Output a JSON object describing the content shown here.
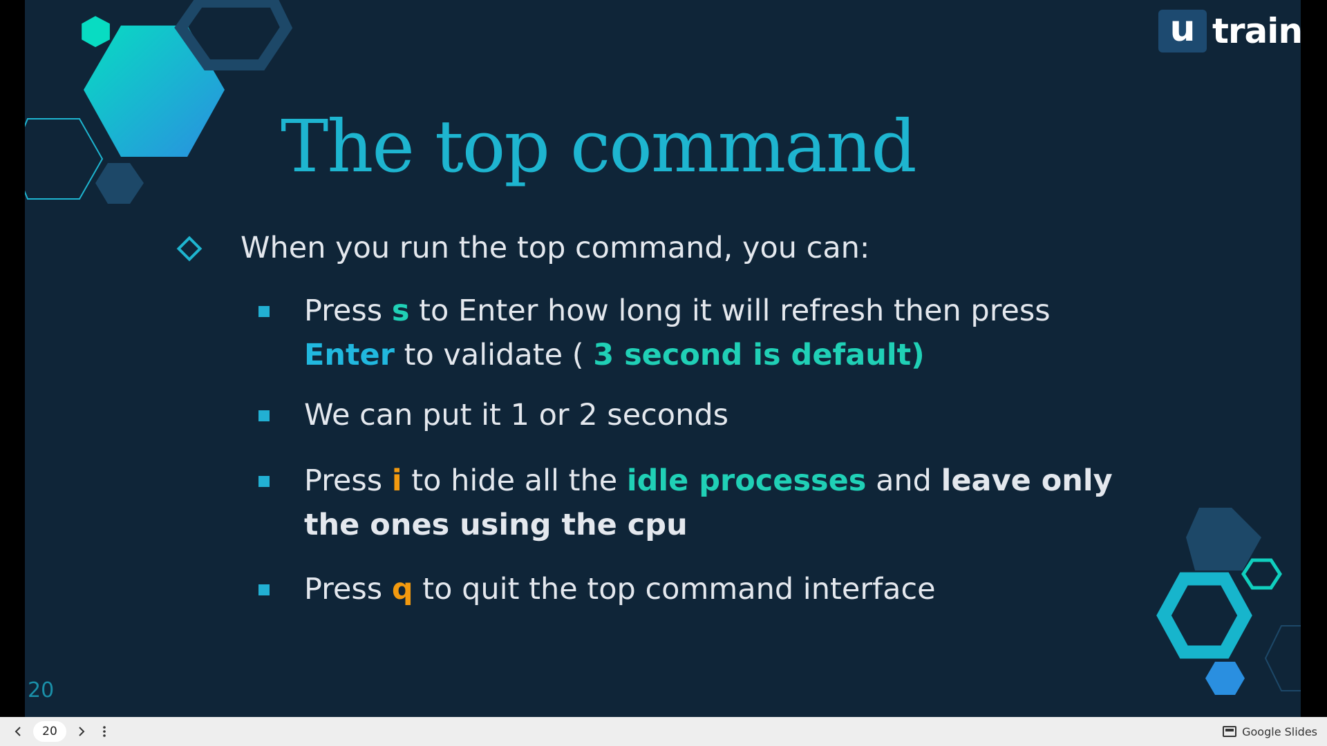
{
  "slide": {
    "title": "The top command",
    "logo": {
      "mark": "u",
      "word": "train"
    },
    "level1": "When you run the top command, you can:",
    "bullets": [
      {
        "p1": "Press ",
        "k1": "s",
        "p2": " to Enter how long it will refresh then press ",
        "k2": "Enter",
        "p3": " to validate ( ",
        "k3": "3 second is default)"
      },
      {
        "text": "We can put it 1 or 2 seconds"
      },
      {
        "p1": "Press ",
        "k1": "i",
        "p2": " to hide all the ",
        "k2": "idle processes",
        "p3": " and ",
        "k3": "leave only the ones using the cpu"
      },
      {
        "p1": "Press ",
        "k1": "q",
        "p2": " to quit the top command interface"
      }
    ],
    "slide_number": "20",
    "colors": {
      "background": "#0f2538",
      "title": "#1eb5d0",
      "teal_highlight": "#20d0b6",
      "orange_highlight": "#f39a0f"
    }
  },
  "player": {
    "prev_icon": "chevron-left-icon",
    "page": "20",
    "next_icon": "chevron-right-icon",
    "menu_icon": "more-vert-icon",
    "brand": "Google Slides"
  }
}
